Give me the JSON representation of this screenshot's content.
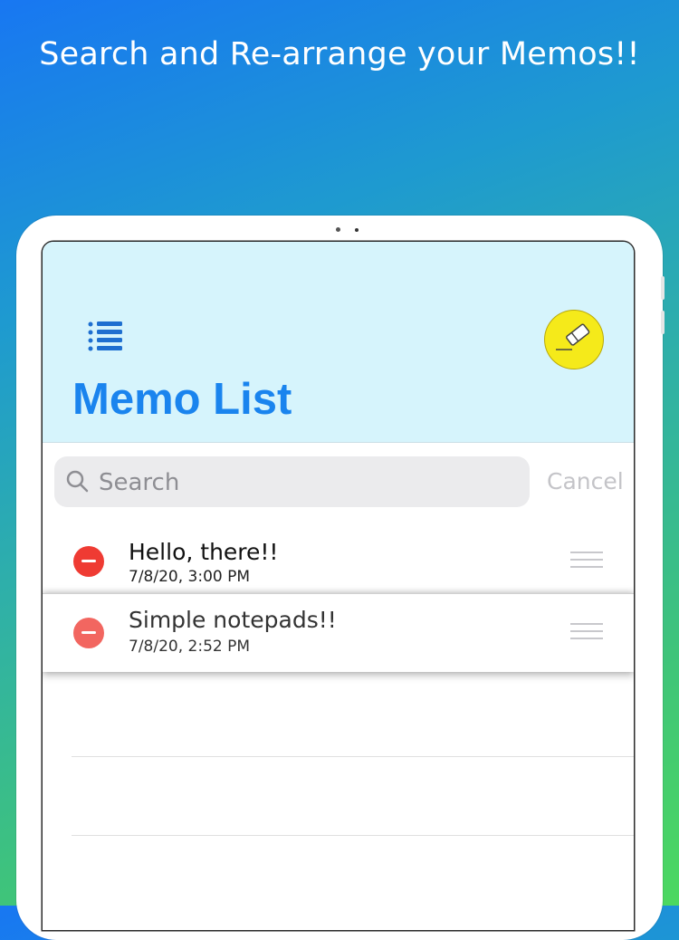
{
  "promo": {
    "title": "Search and Re-arrange your Memos!!"
  },
  "header": {
    "title": "Memo List"
  },
  "search": {
    "placeholder": "Search",
    "cancel_label": "Cancel"
  },
  "memos": [
    {
      "title": "Hello, there!!",
      "date": "7/8/20, 3:00 PM"
    },
    {
      "title": "Simple notepads!!",
      "date": "7/8/20, 2:52 PM"
    }
  ],
  "colors": {
    "accent": "#1a84ee",
    "header_bg": "#d6f4fc",
    "compose_button": "#f5ea1a",
    "delete": "#ef3b33"
  },
  "icons": [
    "list-menu-icon",
    "compose-icon",
    "search-icon",
    "delete-icon",
    "reorder-icon"
  ]
}
